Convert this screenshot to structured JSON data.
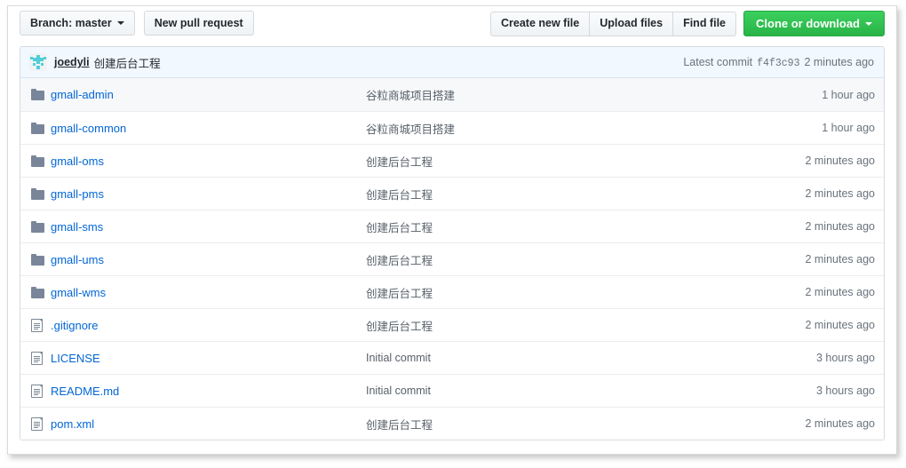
{
  "toolbar": {
    "branch_label": "Branch: master",
    "new_pull_request_label": "New pull request",
    "create_new_file_label": "Create new file",
    "upload_files_label": "Upload files",
    "find_file_label": "Find file",
    "clone_or_download_label": "Clone or download"
  },
  "commit_bar": {
    "author": "joedyli",
    "message": "创建后台工程",
    "latest_commit_label": "Latest commit",
    "sha": "f4f3c93",
    "time": "2 minutes ago"
  },
  "colors": {
    "link": "#0366d6",
    "green_button": "#2cbe4e",
    "commit_bar_bg": "#f1f8ff",
    "row_tint": "#f6f8fa",
    "folder_icon": "#79869a",
    "avatar": "#4ecfd6"
  },
  "files": [
    {
      "name": "gmall-admin",
      "type": "folder",
      "message": "谷粒商城项目搭建",
      "time": "1 hour ago"
    },
    {
      "name": "gmall-common",
      "type": "folder",
      "message": "谷粒商城项目搭建",
      "time": "1 hour ago"
    },
    {
      "name": "gmall-oms",
      "type": "folder",
      "message": "创建后台工程",
      "time": "2 minutes ago"
    },
    {
      "name": "gmall-pms",
      "type": "folder",
      "message": "创建后台工程",
      "time": "2 minutes ago"
    },
    {
      "name": "gmall-sms",
      "type": "folder",
      "message": "创建后台工程",
      "time": "2 minutes ago"
    },
    {
      "name": "gmall-ums",
      "type": "folder",
      "message": "创建后台工程",
      "time": "2 minutes ago"
    },
    {
      "name": "gmall-wms",
      "type": "folder",
      "message": "创建后台工程",
      "time": "2 minutes ago"
    },
    {
      "name": ".gitignore",
      "type": "file",
      "message": "创建后台工程",
      "time": "2 minutes ago"
    },
    {
      "name": "LICENSE",
      "type": "file",
      "message": "Initial commit",
      "time": "3 hours ago"
    },
    {
      "name": "README.md",
      "type": "file",
      "message": "Initial commit",
      "time": "3 hours ago"
    },
    {
      "name": "pom.xml",
      "type": "file",
      "message": "创建后台工程",
      "time": "2 minutes ago"
    }
  ]
}
